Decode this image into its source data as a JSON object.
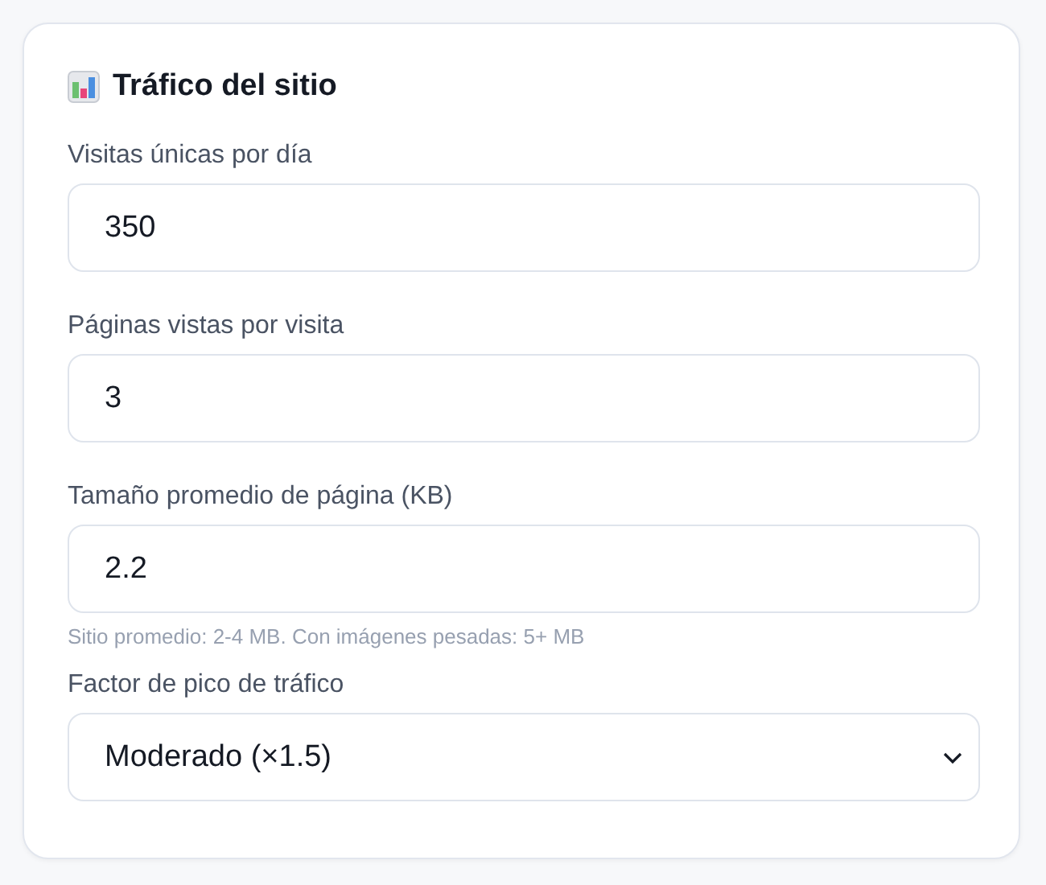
{
  "card": {
    "title": "Tráfico del sitio"
  },
  "fields": [
    {
      "kind": "input",
      "label": "Visitas únicas por día",
      "value": "350"
    },
    {
      "kind": "input",
      "label": "Páginas vistas por visita",
      "value": "3"
    },
    {
      "kind": "input",
      "label": "Tamaño promedio de página (KB)",
      "value": "2.2",
      "hint": "Sitio promedio: 2-4 MB. Con imágenes pesadas: 5+ MB"
    },
    {
      "kind": "select",
      "label": "Factor de pico de tráfico",
      "value": "Moderado (×1.5)"
    }
  ]
}
